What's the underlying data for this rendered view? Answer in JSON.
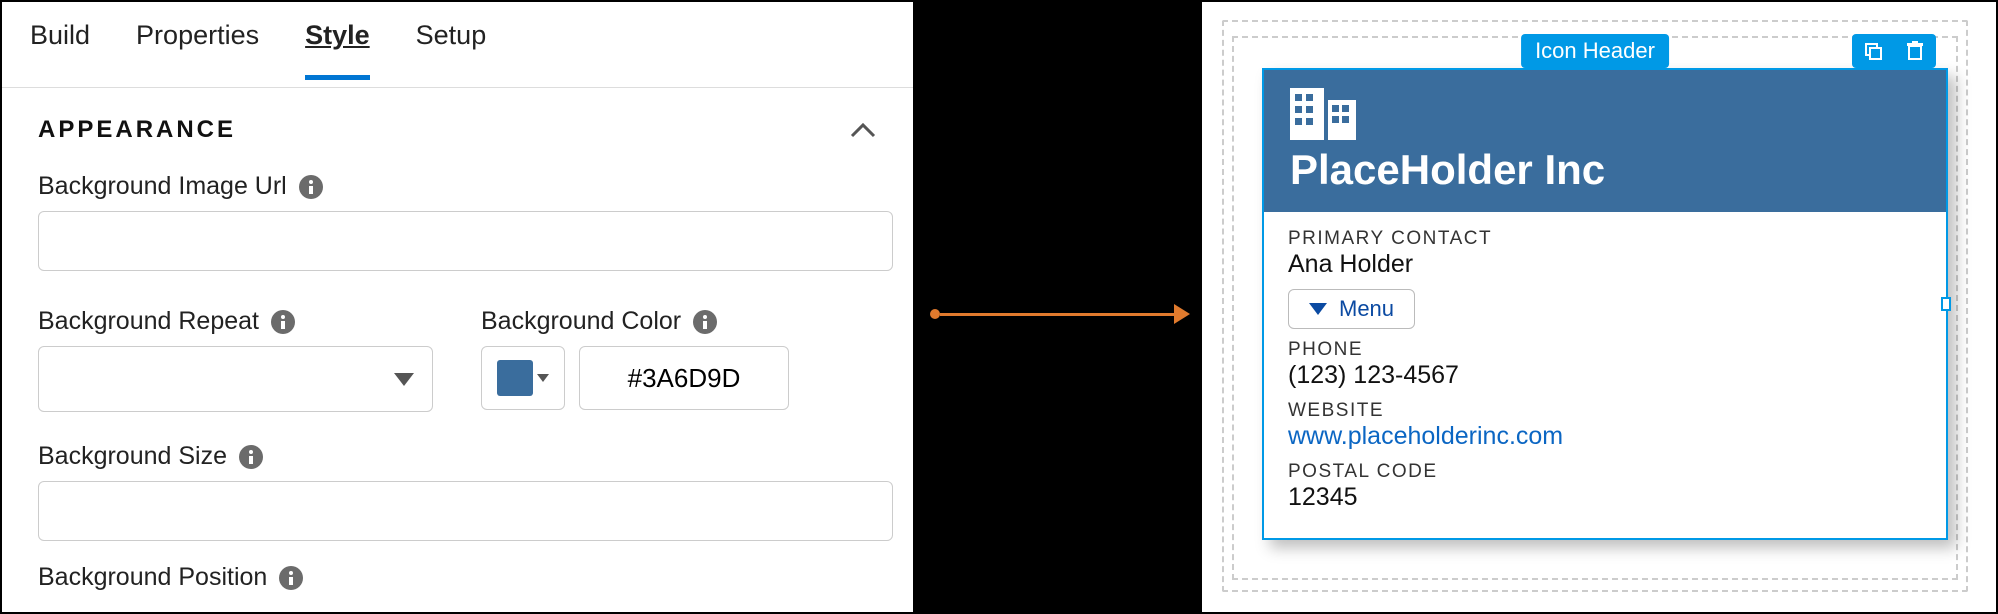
{
  "tabs": {
    "build": "Build",
    "properties": "Properties",
    "style": "Style",
    "setup": "Setup"
  },
  "appearance": {
    "title": "APPEARANCE",
    "bg_image_url": {
      "label": "Background Image Url",
      "value": ""
    },
    "bg_repeat": {
      "label": "Background Repeat",
      "value": ""
    },
    "bg_color": {
      "label": "Background Color",
      "hex": "#3A6D9D"
    },
    "bg_size": {
      "label": "Background Size",
      "value": ""
    },
    "bg_position": {
      "label": "Background Position"
    }
  },
  "preview": {
    "selection_tag": "Icon Header",
    "card": {
      "title": "PlaceHolder Inc",
      "fields": {
        "primary_contact": {
          "label": "PRIMARY CONTACT",
          "value": "Ana Holder"
        },
        "menu_label": "Menu",
        "phone": {
          "label": "PHONE",
          "value": "(123) 123-4567"
        },
        "website": {
          "label": "WEBSITE",
          "value": "www.placeholderinc.com"
        },
        "postal": {
          "label": "POSTAL CODE",
          "value": "12345"
        }
      }
    }
  }
}
